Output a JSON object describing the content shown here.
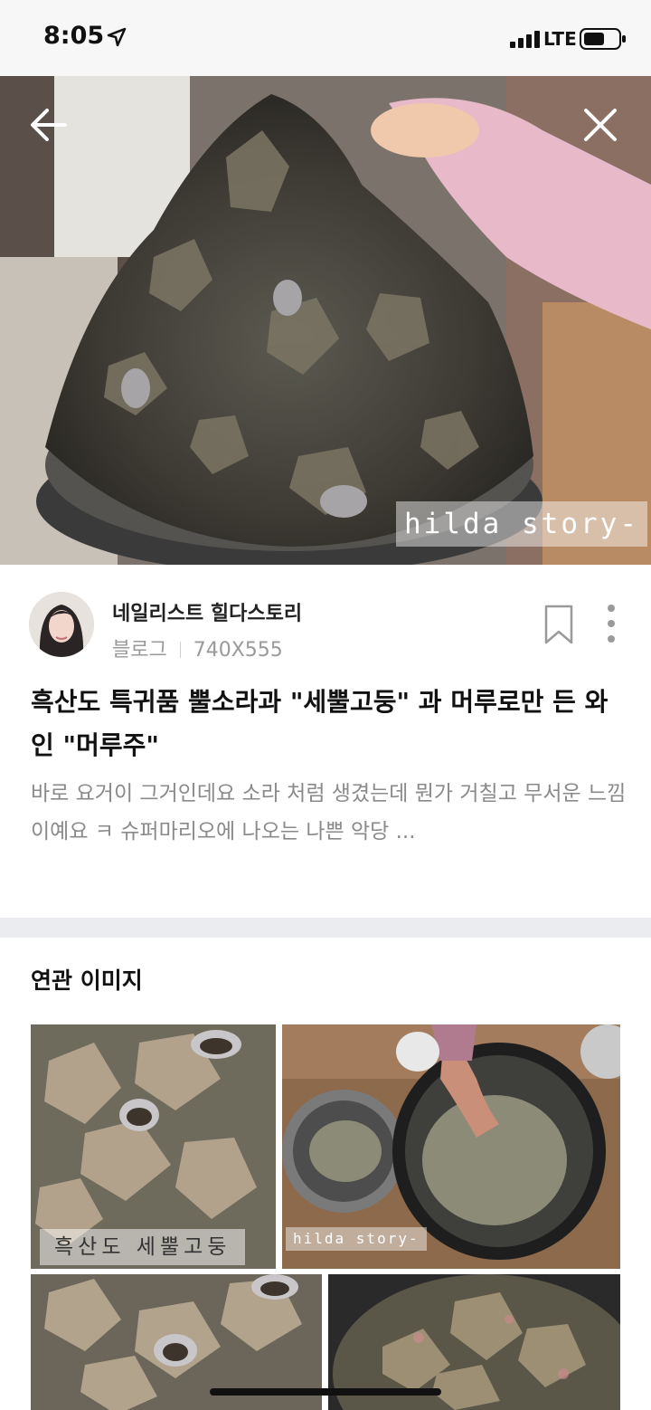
{
  "status_bar": {
    "time": "8:05",
    "network": "LTE"
  },
  "hero": {
    "watermark": "hilda story-"
  },
  "post": {
    "author": "네일리스트 힐다스토리",
    "source": "블로그",
    "dimensions": "740X555",
    "title": "흑산도 특귀품 뿔소라과 \"세뿔고둥\" 과 머루로만 든 와인 \"머루주\"",
    "summary": "바로 요거이 그거인데요 소라 처럼 생겼는데 뭔가 거칠고 무서운 느낌이예요 ㅋ 슈퍼마리오에 나오는 나쁜 악당 ..."
  },
  "related": {
    "heading": "연관 이미지",
    "thumb1_label": "흑산도 세뿔고둥",
    "thumb2_label": "hilda story-"
  },
  "icons": [
    "location-arrow-icon",
    "signal-icon",
    "battery-icon",
    "back-arrow-icon",
    "close-icon",
    "bookmark-icon",
    "more-vertical-icon"
  ]
}
